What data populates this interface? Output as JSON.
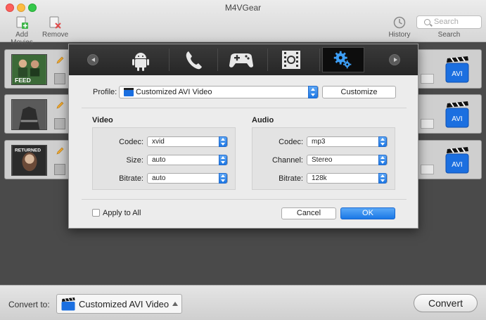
{
  "app": {
    "title": "M4VGear"
  },
  "toolbar": {
    "add_movies": "Add Movies",
    "remove": "Remove",
    "history": "History",
    "search_placeholder": "Search",
    "search_label": "Search"
  },
  "movies": [
    {
      "thumb_text": "FEED"
    },
    {
      "thumb_text": ""
    },
    {
      "thumb_text": "RETURNED"
    }
  ],
  "output_badge": "AVI",
  "dialog": {
    "categories": [
      "android-icon",
      "phone-icon",
      "gamepad-icon",
      "film-icon",
      "settings-icon"
    ],
    "selected_category": "settings-icon",
    "profile_label": "Profile:",
    "profile_value": "Customized AVI Video",
    "customize_label": "Customize",
    "video": {
      "title": "Video",
      "codec_label": "Codec:",
      "codec_value": "xvid",
      "size_label": "Size:",
      "size_value": "auto",
      "bitrate_label": "Bitrate:",
      "bitrate_value": "auto"
    },
    "audio": {
      "title": "Audio",
      "codec_label": "Codec:",
      "codec_value": "mp3",
      "channel_label": "Channel:",
      "channel_value": "Stereo",
      "bitrate_label": "Bitrate:",
      "bitrate_value": "128k"
    },
    "apply_all_label": "Apply to All",
    "cancel_label": "Cancel",
    "ok_label": "OK"
  },
  "bottom": {
    "convert_to_label": "Convert to:",
    "format_value": "Customized AVI Video",
    "convert_label": "Convert"
  },
  "colors": {
    "accent": "#1a78e6",
    "dialog_header": "#262626"
  }
}
